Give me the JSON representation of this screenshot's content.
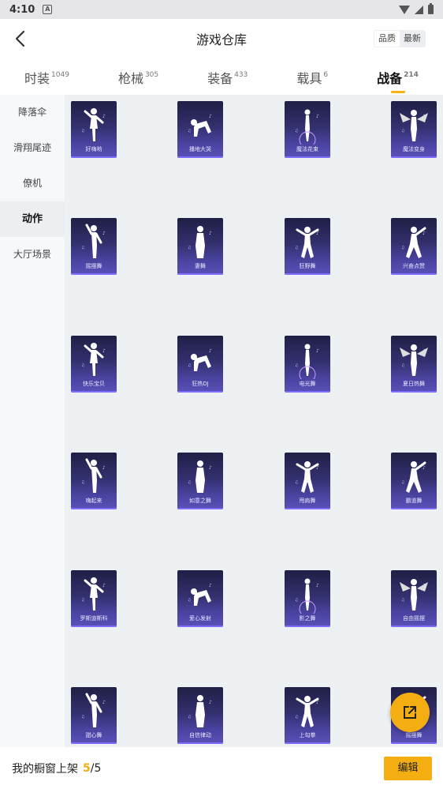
{
  "status": {
    "time": "4:10"
  },
  "header": {
    "title": "游戏仓库",
    "sort_quality": "品质",
    "sort_latest": "最新"
  },
  "tabs": [
    {
      "label": "时装",
      "count": "1049"
    },
    {
      "label": "枪械",
      "count": "305"
    },
    {
      "label": "装备",
      "count": "433"
    },
    {
      "label": "载具",
      "count": "6"
    },
    {
      "label": "战备",
      "count": "214"
    }
  ],
  "sidebar": [
    "降落伞",
    "滑翔尾迹",
    "僚机",
    "动作",
    "大厅场景"
  ],
  "items": [
    "好嗨哟",
    "播地大哭",
    "魔法花束",
    "魔法变身",
    "摇摆舞",
    "妻舞",
    "狂野舞",
    "兴奋点赞",
    "快乐宝贝",
    "狂热DJ",
    "电光舞",
    "夏日热舞",
    "嗨起来",
    "如意之舞",
    "甩肩舞",
    "霸道舞",
    "罗斯迪斯科",
    "爱心发射",
    "影之舞",
    "自由摇摆",
    "甜心舞",
    "自信律动",
    "上勾拳",
    "摇摆舞"
  ],
  "bottom": {
    "label": "我的橱窗上架",
    "current": "5",
    "separator": "/",
    "max": "5",
    "edit": "编辑"
  },
  "colors": {
    "accent": "#f5ae12",
    "card_top": "#1f1f45",
    "card_bottom": "#5a51b8"
  }
}
